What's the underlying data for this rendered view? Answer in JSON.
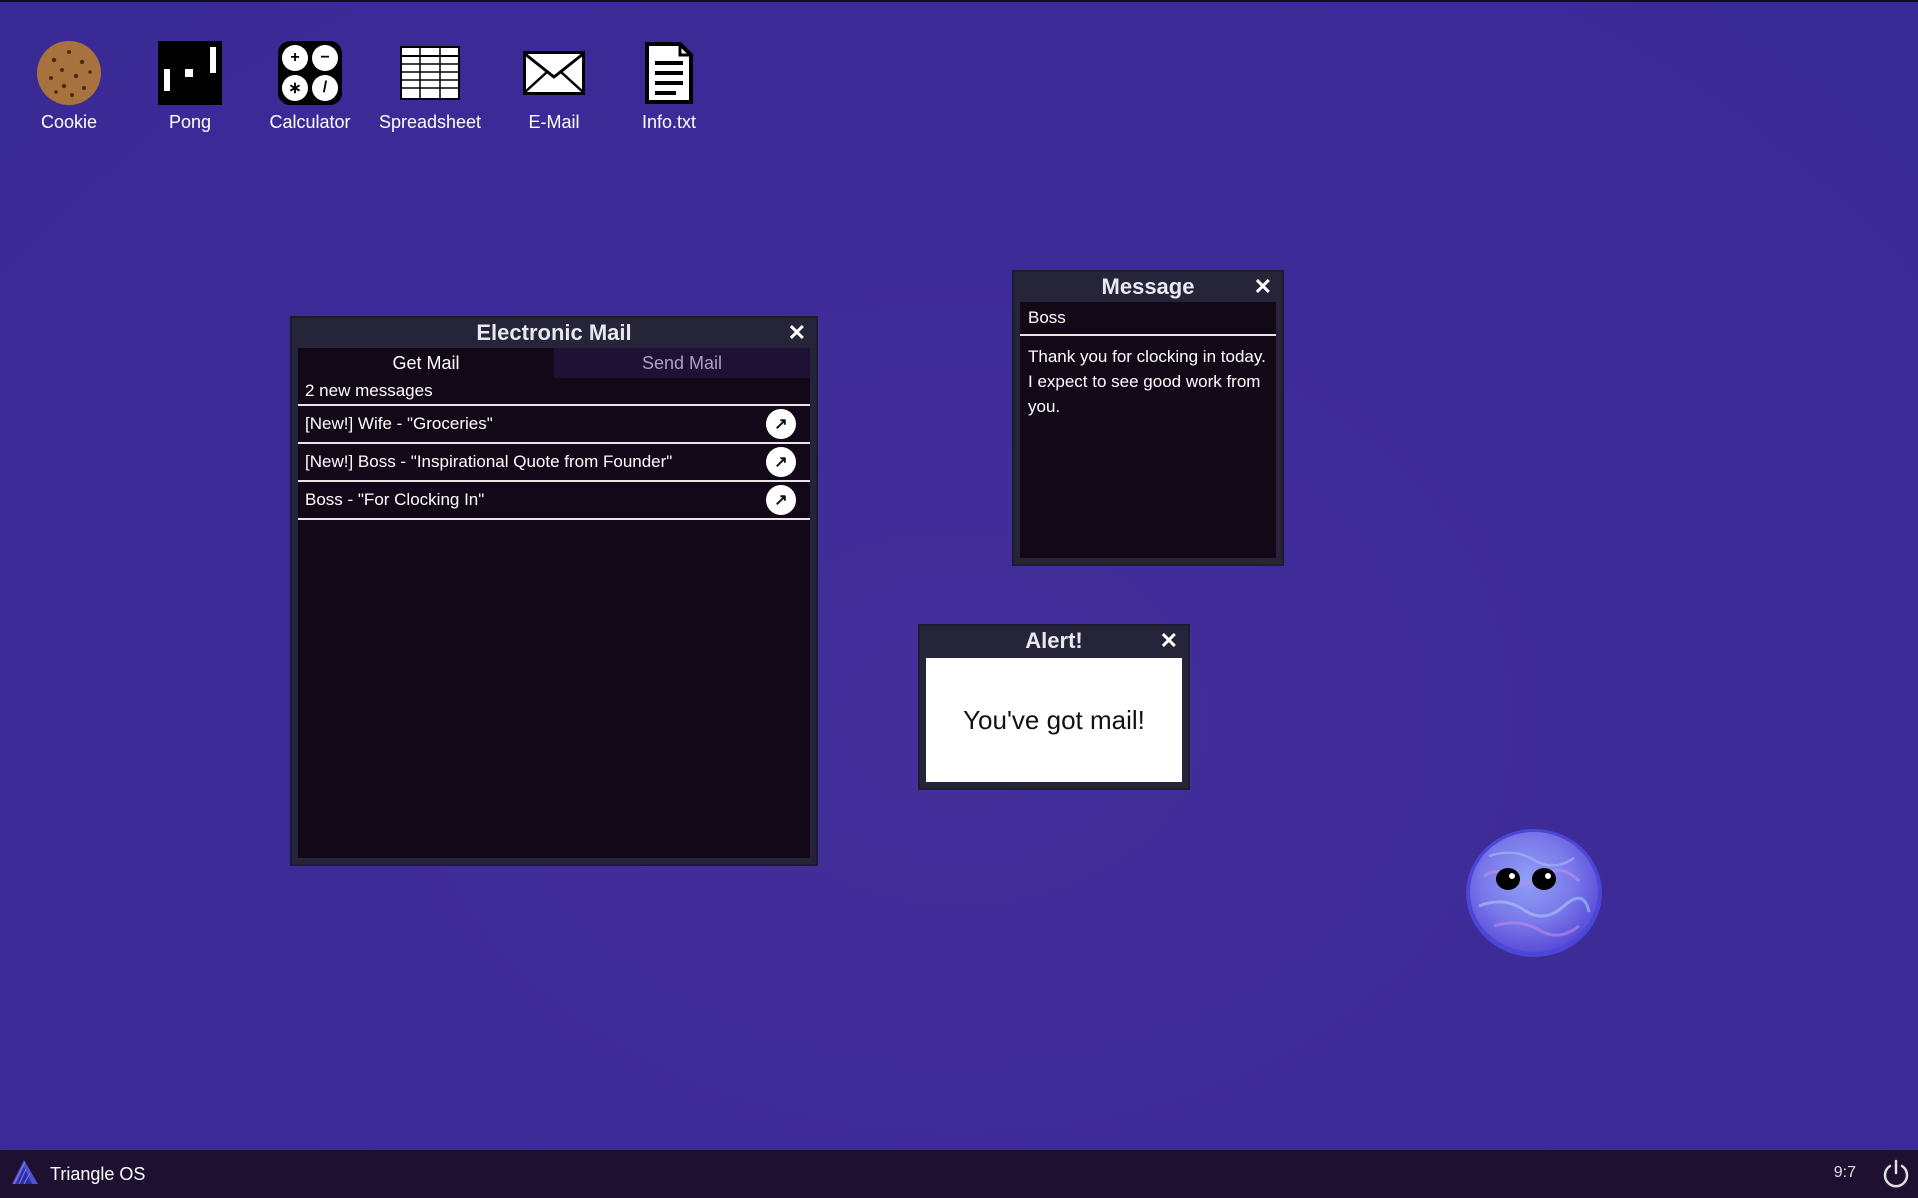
{
  "desktop": {
    "icons": [
      {
        "label": "Cookie",
        "icon": "cookie-icon"
      },
      {
        "label": "Pong",
        "icon": "pong-icon"
      },
      {
        "label": "Calculator",
        "icon": "calculator-icon"
      },
      {
        "label": "Spreadsheet",
        "icon": "spreadsheet-icon"
      },
      {
        "label": "E-Mail",
        "icon": "envelope-icon"
      },
      {
        "label": "Info.txt",
        "icon": "document-icon"
      }
    ],
    "calculator_symbols": [
      "+",
      "−",
      "∗",
      "/"
    ]
  },
  "email_window": {
    "title": "Electronic Mail",
    "close": "✕",
    "tabs": [
      {
        "label": "Get Mail",
        "active": true
      },
      {
        "label": "Send Mail",
        "active": false
      }
    ],
    "count": "2 new messages",
    "open_glyph": "↗",
    "messages": [
      {
        "text": "[New!] Wife - \"Groceries\""
      },
      {
        "text": "[New!] Boss - \"Inspirational Quote from Founder\""
      },
      {
        "text": "Boss - \"For Clocking In\""
      }
    ]
  },
  "message_window": {
    "title": "Message",
    "close": "✕",
    "from": "Boss",
    "body": "Thank you for clocking in today. I expect to see good work from you."
  },
  "alert_window": {
    "title": "Alert!",
    "close": "✕",
    "text": "You've got mail!"
  },
  "taskbar": {
    "os_name": "Triangle OS",
    "clock": "9:7"
  },
  "colors": {
    "desktop_bg": "#3d2b98",
    "window_frame": "#262438",
    "window_body": "#120818",
    "taskbar": "#1d1030"
  }
}
